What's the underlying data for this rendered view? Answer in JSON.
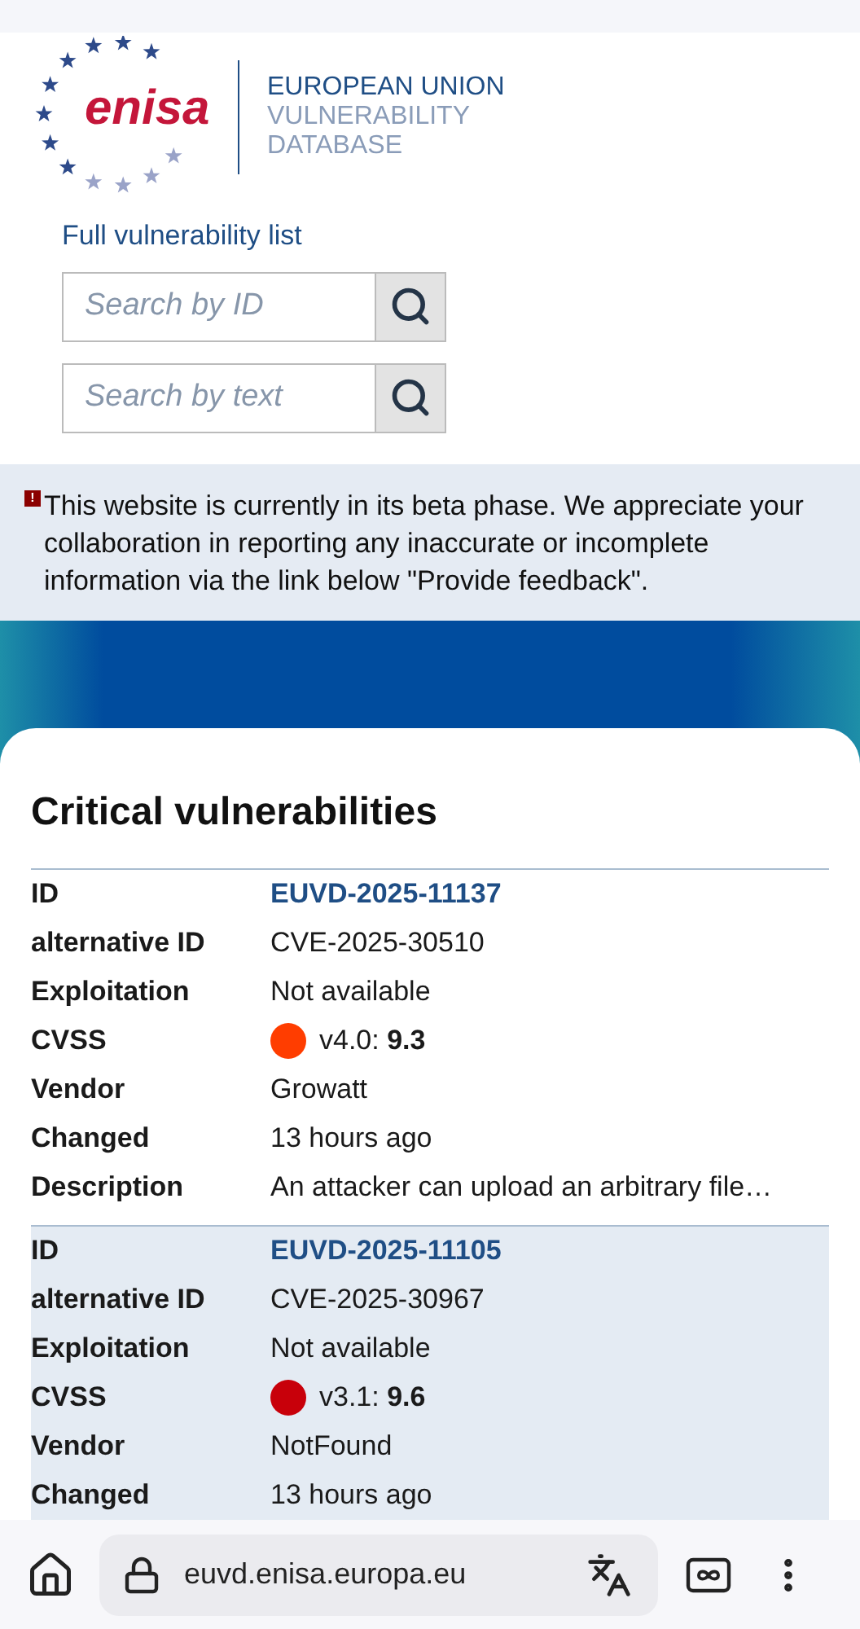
{
  "logo": {
    "wordmark": "enisa",
    "lines": [
      "EUROPEAN UNION",
      "VULNERABILITY",
      "DATABASE"
    ]
  },
  "nav_link": "Full vulnerability list",
  "searches": [
    {
      "placeholder": "Search by ID"
    },
    {
      "placeholder": "Search by text"
    }
  ],
  "notice": {
    "icon": "!",
    "text": "This website is currently in its beta phase. We appreciate your collaboration in reporting any inaccurate or incomplete information via the link below \"Provide feedback\"."
  },
  "section_title": "Critical vulnerabilities",
  "vulnerabilities": [
    {
      "rows": [
        {
          "kind": "link",
          "label": "ID",
          "value": "EUVD-2025-11137"
        },
        {
          "kind": "text",
          "label": "alternative ID",
          "value": "CVE-2025-30510"
        },
        {
          "kind": "text",
          "label": "Exploitation",
          "value": "Not available"
        },
        {
          "kind": "score",
          "label": "CVSS",
          "value": "v4.0: **9.3**",
          "color": "#ff3d00"
        },
        {
          "kind": "text",
          "label": "Vendor",
          "value": "Growatt"
        },
        {
          "kind": "text",
          "label": "Changed",
          "value": "13 hours ago"
        },
        {
          "kind": "text",
          "label": "Description",
          "value": "An attacker can upload an arbitrary file…"
        }
      ]
    },
    {
      "rows": [
        {
          "kind": "link",
          "label": "ID",
          "value": "EUVD-2025-11105"
        },
        {
          "kind": "text",
          "label": "alternative ID",
          "value": "CVE-2025-30967"
        },
        {
          "kind": "text",
          "label": "Exploitation",
          "value": "Not available"
        },
        {
          "kind": "score",
          "label": "CVSS",
          "value": "v3.1: **9.6**",
          "color": "#c8000a"
        },
        {
          "kind": "text",
          "label": "Vendor",
          "value": "NotFound"
        },
        {
          "kind": "text",
          "label": "Changed",
          "value": "13 hours ago"
        }
      ]
    }
  ],
  "browser": {
    "url": "euvd.enisa.europa.eu"
  }
}
